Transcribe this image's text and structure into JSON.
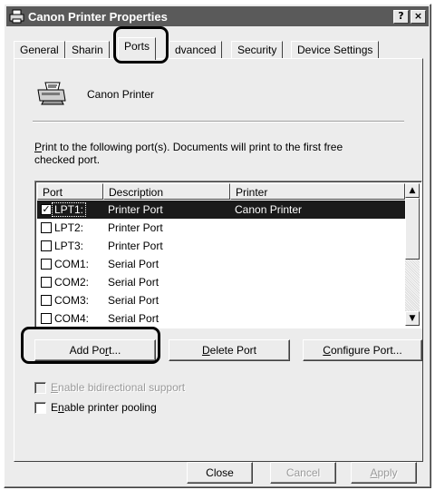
{
  "window": {
    "title": "Canon Printer Properties"
  },
  "titlebar_buttons": {
    "help": "?",
    "close": "×"
  },
  "tabs": [
    {
      "label": "General"
    },
    {
      "label": "Sharin"
    },
    {
      "label": "Ports",
      "active": true
    },
    {
      "label": "dvanced"
    },
    {
      "label": "Security"
    },
    {
      "label": "Device Settings"
    }
  ],
  "printer": {
    "name": "Canon Printer",
    "icon": "printer-icon"
  },
  "instructions": {
    "mnemonic": "P",
    "rest_line1": "rint to the following port(s). Documents will print to the first free",
    "line2": "checked port."
  },
  "ports_list": {
    "columns": [
      "Port",
      "Description",
      "Printer"
    ],
    "rows": [
      {
        "port": "LPT1:",
        "description": "Printer Port",
        "printer": "Canon Printer",
        "checked": true,
        "selected": true
      },
      {
        "port": "LPT2:",
        "description": "Printer Port",
        "printer": "",
        "checked": false
      },
      {
        "port": "LPT3:",
        "description": "Printer Port",
        "printer": "",
        "checked": false
      },
      {
        "port": "COM1:",
        "description": "Serial Port",
        "printer": "",
        "checked": false
      },
      {
        "port": "COM2:",
        "description": "Serial Port",
        "printer": "",
        "checked": false
      },
      {
        "port": "COM3:",
        "description": "Serial Port",
        "printer": "",
        "checked": false
      },
      {
        "port": "COM4:",
        "description": "Serial Port",
        "printer": "",
        "checked": false
      }
    ]
  },
  "scrollbar": {
    "up_arrow": "▲",
    "down_arrow": "▼"
  },
  "port_buttons": {
    "add": {
      "a": "Add Po",
      "m": "r",
      "b": "t..."
    },
    "delete": {
      "a": "",
      "m": "D",
      "b": "elete Port"
    },
    "configure": {
      "a": "",
      "m": "C",
      "b": "onfigure Port..."
    }
  },
  "options": {
    "bidirectional": {
      "m": "E",
      "b": "nable bidirectional support",
      "enabled": false,
      "checked": false
    },
    "pooling": {
      "a": "E",
      "m": "n",
      "b": "able printer pooling",
      "enabled": true,
      "checked": false
    }
  },
  "footer": {
    "close": "Close",
    "cancel": "Cancel",
    "apply_m": "A",
    "apply_b": "pply",
    "cancel_enabled": false,
    "apply_enabled": false
  },
  "colors": {
    "titlebar": "#5a5a5a",
    "selection": "#1a1a1a",
    "face": "#ececec"
  }
}
